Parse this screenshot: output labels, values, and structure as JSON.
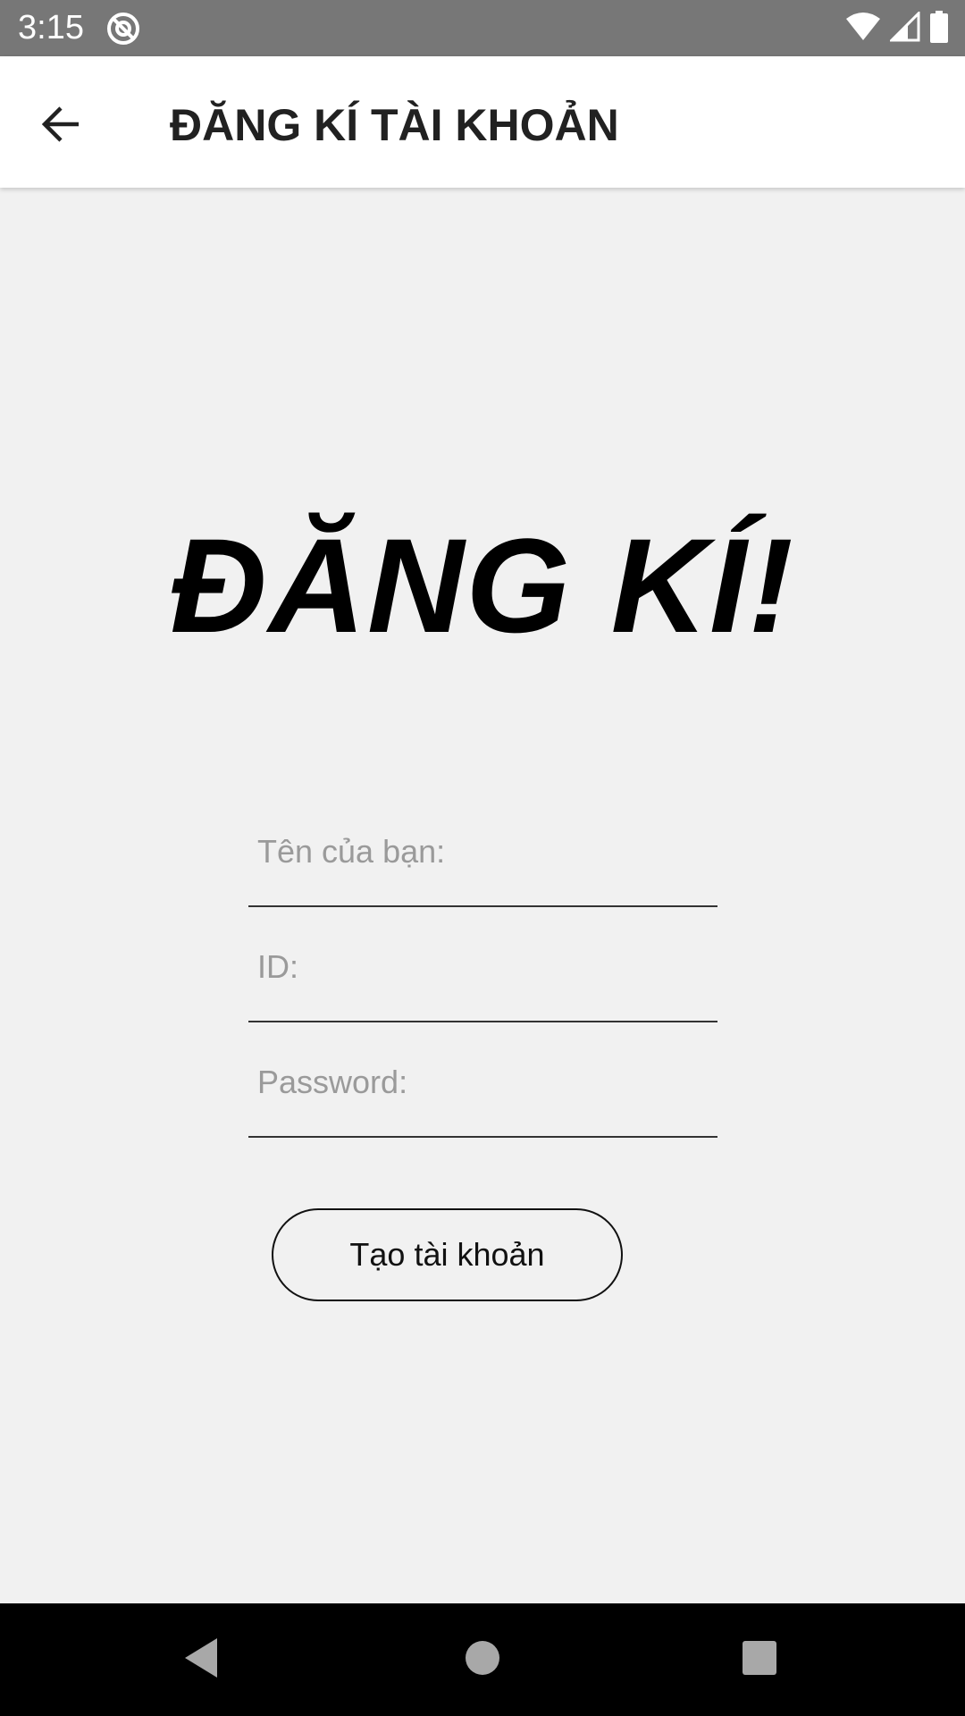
{
  "status_bar": {
    "time": "3:15",
    "icons": [
      "notification-icon",
      "wifi-icon",
      "signal-icon",
      "battery-icon"
    ]
  },
  "app_bar": {
    "title": "ĐĂNG KÍ TÀI KHOẢN",
    "back_icon": "arrow-back-icon"
  },
  "main": {
    "heading": "ĐĂNG KÍ!",
    "fields": {
      "name": {
        "placeholder": "Tên của bạn:",
        "value": ""
      },
      "id": {
        "placeholder": "ID:",
        "value": ""
      },
      "password": {
        "placeholder": "Password:",
        "value": ""
      }
    },
    "create_button_label": "Tạo tài khoản"
  },
  "nav_bar": {
    "icons": [
      "nav-back-icon",
      "nav-home-icon",
      "nav-recents-icon"
    ]
  },
  "colors": {
    "status_bar_bg": "#777777",
    "app_bar_bg": "#ffffff",
    "content_bg": "#f1f1f1",
    "nav_bar_bg": "#000000"
  }
}
